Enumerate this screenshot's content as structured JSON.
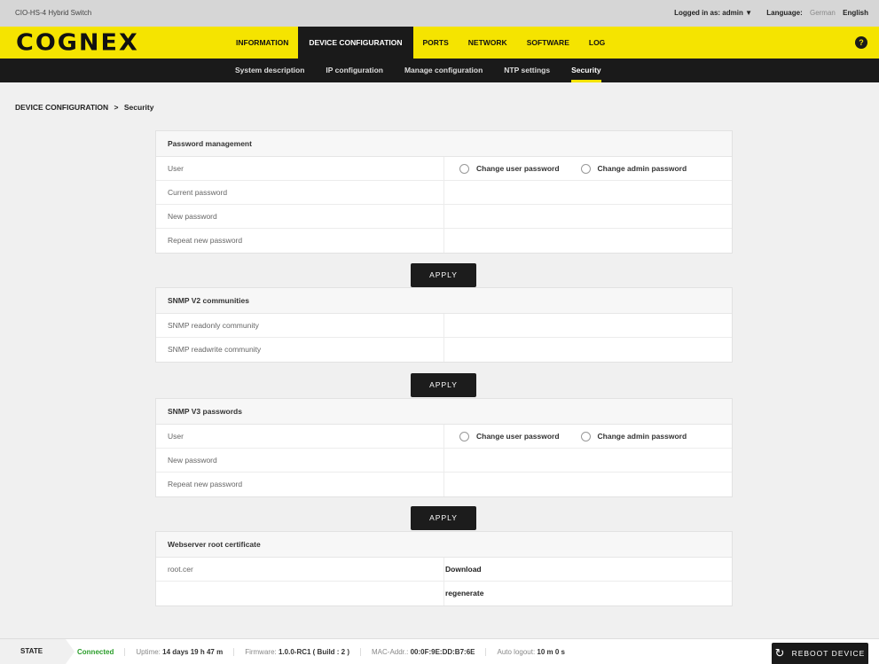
{
  "topbar": {
    "device_name": "CIO-HS-4 Hybrid Switch",
    "logged_in_label": "Logged in as:",
    "user": "admin ▼",
    "language_label": "Language:",
    "lang_german": "German",
    "lang_english": "English"
  },
  "brand": {
    "logo": "COGNEX",
    "help_icon": "?"
  },
  "mainnav": [
    "INFORMATION",
    "DEVICE CONFIGURATION",
    "PORTS",
    "NETWORK",
    "SOFTWARE",
    "LOG"
  ],
  "subnav": [
    "System description",
    "IP configuration",
    "Manage configuration",
    "NTP settings",
    "Security"
  ],
  "breadcrumb": {
    "section": "DEVICE CONFIGURATION",
    "separator": ">",
    "page": "Security"
  },
  "password_management": {
    "title": "Password management",
    "user_label": "User",
    "radio_user": "Change user password",
    "radio_admin": "Change admin password",
    "current_label": "Current password",
    "new_label": "New password",
    "repeat_label": "Repeat new password"
  },
  "snmp_v2": {
    "title": "SNMP V2 communities",
    "readonly_label": "SNMP readonly community",
    "readwrite_label": "SNMP readwrite community"
  },
  "snmp_v3": {
    "title": "SNMP V3 passwords",
    "user_label": "User",
    "radio_user": "Change user password",
    "radio_admin": "Change admin password",
    "new_label": "New password",
    "repeat_label": "Repeat new password"
  },
  "webserver": {
    "title": "Webserver root certificate",
    "file_label": "root.cer",
    "download": "Download",
    "regenerate": "regenerate"
  },
  "apply_label": "APPLY",
  "status": {
    "state_label": "STATE",
    "connection": "Connected",
    "uptime_label": "Uptime:",
    "uptime": "14 days 19 h 47 m",
    "firmware_label": "Firmware:",
    "firmware": "1.0.0-RC1 ( Build : 2 )",
    "mac_label": "MAC-Addr.:",
    "mac": "00:0F:9E:DD:B7:6E",
    "logout_label": "Auto logout:",
    "logout": "10 m 0 s",
    "reboot": "REBOOT DEVICE"
  },
  "colors": {
    "brand_yellow": "#f5e400",
    "dark": "#1a1a1a",
    "connected_green": "#2a9d2a"
  },
  "icons": {
    "help": "help-icon",
    "reboot": "refresh-icon"
  }
}
